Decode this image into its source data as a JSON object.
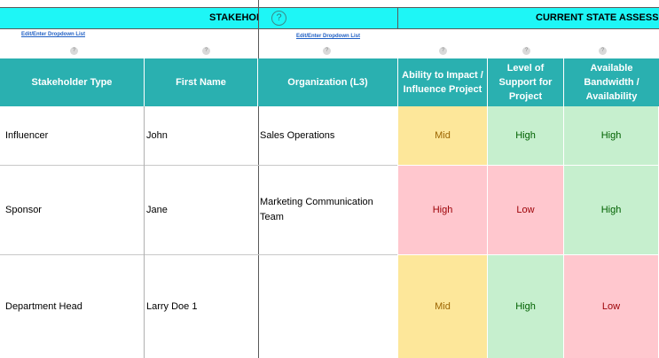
{
  "banner": {
    "left_title": "STAKEHOLD",
    "help_symbol": "?",
    "right_title": "CURRENT STATE ASSESSM",
    "color": "#1ef6f6"
  },
  "links": {
    "edit_dropdown_1": "Edit/Enter Dropdown List",
    "edit_dropdown_2": "Edit/Enter Dropdown List"
  },
  "help_marker": "?",
  "header": {
    "color": "#2ab0b0",
    "columns": [
      "Stakeholder Type",
      "First Name",
      "Organization (L3)",
      "Ability to Impact / Influence Project",
      "Level of Support for Project",
      "Available Bandwidth / Availability"
    ]
  },
  "rows": [
    {
      "type": "Influencer",
      "first_name": "John",
      "organization": "Sales Operations",
      "impact": "Mid",
      "support": "High",
      "bandwidth": "High"
    },
    {
      "type": "Sponsor",
      "first_name": "Jane",
      "organization": "Marketing Communication Team",
      "impact": "High",
      "support": "Low",
      "bandwidth": "High"
    },
    {
      "type": "Department Head",
      "first_name": "Larry Doe 1",
      "organization": "",
      "impact": "Mid",
      "support": "High",
      "bandwidth": "Low"
    }
  ],
  "rating_colors": {
    "Mid": "#fde79a",
    "High": "#c6efce",
    "Low": "#ffc7ce"
  }
}
